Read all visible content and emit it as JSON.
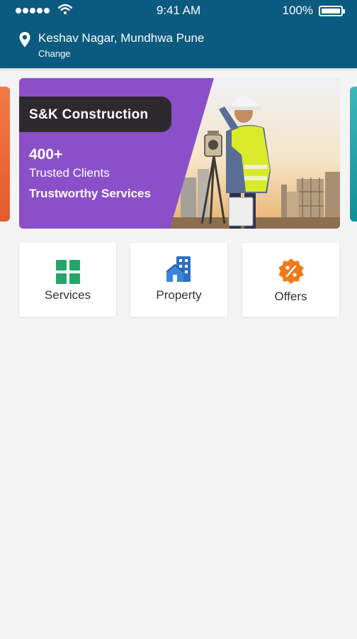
{
  "status_bar": {
    "time": "9:41 AM",
    "battery": "100%",
    "icons": [
      "signal-dots-icon",
      "wifi-icon",
      "battery-icon"
    ]
  },
  "location": {
    "name": "Keshav Nagar, Mundhwa Pune",
    "change_label": "Change",
    "icon": "location-pin-icon"
  },
  "banner": {
    "brand": "S&K Construction",
    "count": "400+",
    "count_label": "Trusted Clients",
    "tagline": "Trustworthy Services"
  },
  "categories": [
    {
      "label": "Services",
      "icon": "grid-icon",
      "color": "#25a56a"
    },
    {
      "label": "Property",
      "icon": "building-icon",
      "color": "#2d6fc6"
    },
    {
      "label": "Offers",
      "icon": "discount-badge-icon",
      "color": "#f07a1a"
    }
  ],
  "colors": {
    "primary": "#0b5a7f",
    "banner_purple": "#8c4fca",
    "background": "#f4f4f5"
  }
}
